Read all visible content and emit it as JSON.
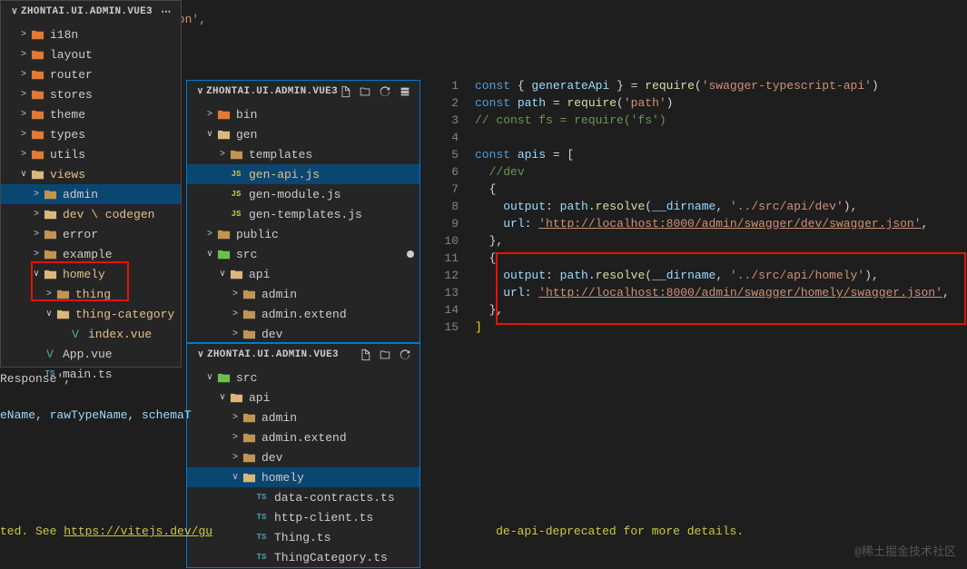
{
  "header_title": "ZHONTAI.UI.ADMIN.VUE3",
  "sidebar1": {
    "items": [
      {
        "chev": ">",
        "cls": "folder-red",
        "label": "i18n",
        "ind": 1
      },
      {
        "chev": ">",
        "cls": "folder-red",
        "label": "layout",
        "ind": 1
      },
      {
        "chev": ">",
        "cls": "folder-red",
        "label": "router",
        "ind": 1
      },
      {
        "chev": ">",
        "cls": "folder-red",
        "label": "stores",
        "ind": 1
      },
      {
        "chev": ">",
        "cls": "folder-red",
        "label": "theme",
        "ind": 1
      },
      {
        "chev": ">",
        "cls": "folder-red",
        "label": "types",
        "ind": 1
      },
      {
        "chev": ">",
        "cls": "folder-red",
        "label": "utils",
        "ind": 1
      },
      {
        "chev": "∨",
        "cls": "folder-open",
        "label": "views",
        "ind": 1,
        "orange": true
      },
      {
        "chev": ">",
        "cls": "folder",
        "label": "admin",
        "ind": 2,
        "sel": true
      },
      {
        "chev": ">",
        "cls": "folder-open",
        "label": "dev \\ codegen",
        "ind": 2,
        "orange": true
      },
      {
        "chev": ">",
        "cls": "folder",
        "label": "error",
        "ind": 2
      },
      {
        "chev": ">",
        "cls": "folder",
        "label": "example",
        "ind": 2
      },
      {
        "chev": "∨",
        "cls": "folder-open",
        "label": "homely",
        "ind": 2,
        "orange": true
      },
      {
        "chev": ">",
        "cls": "folder",
        "label": "thing",
        "ind": 3,
        "orange": true
      },
      {
        "chev": "∨",
        "cls": "folder-open",
        "label": "thing-category",
        "ind": 3,
        "orange": true
      },
      {
        "chev": "",
        "cls": "file-vue",
        "file": "V",
        "label": "index.vue",
        "ind": 4,
        "orange": true
      },
      {
        "chev": "",
        "cls": "file-vue",
        "file": "V",
        "label": "App.vue",
        "ind": 2
      },
      {
        "chev": "",
        "cls": "file-ts",
        "file": "TS",
        "label": "main.ts",
        "ind": 2
      }
    ]
  },
  "sidebar2": {
    "items": [
      {
        "chev": ">",
        "cls": "folder-red",
        "label": "bin",
        "ind": 1,
        "red": true
      },
      {
        "chev": "∨",
        "cls": "folder-open",
        "label": "gen",
        "ind": 1
      },
      {
        "chev": ">",
        "cls": "folder",
        "label": "templates",
        "ind": 2
      },
      {
        "chev": "",
        "cls": "file-js",
        "file": "JS",
        "label": "gen-api.js",
        "ind": 2,
        "sel": true,
        "orange": true
      },
      {
        "chev": "",
        "cls": "file-js",
        "file": "JS",
        "label": "gen-module.js",
        "ind": 2
      },
      {
        "chev": "",
        "cls": "file-js",
        "file": "JS",
        "label": "gen-templates.js",
        "ind": 2
      },
      {
        "chev": ">",
        "cls": "folder",
        "label": "public",
        "ind": 1
      },
      {
        "chev": "∨",
        "cls": "folder-src",
        "label": "src",
        "ind": 1,
        "dot": true
      },
      {
        "chev": "∨",
        "cls": "folder-open",
        "label": "api",
        "ind": 2
      },
      {
        "chev": ">",
        "cls": "folder",
        "label": "admin",
        "ind": 3
      },
      {
        "chev": ">",
        "cls": "folder",
        "label": "admin.extend",
        "ind": 3
      },
      {
        "chev": ">",
        "cls": "folder",
        "label": "dev",
        "ind": 3
      }
    ]
  },
  "sidebar3": {
    "items": [
      {
        "chev": "∨",
        "cls": "folder-src",
        "label": "src",
        "ind": 1
      },
      {
        "chev": "∨",
        "cls": "folder-open",
        "label": "api",
        "ind": 2
      },
      {
        "chev": ">",
        "cls": "folder",
        "label": "admin",
        "ind": 3
      },
      {
        "chev": ">",
        "cls": "folder",
        "label": "admin.extend",
        "ind": 3
      },
      {
        "chev": ">",
        "cls": "folder",
        "label": "dev",
        "ind": 3
      },
      {
        "chev": "∨",
        "cls": "folder-open",
        "label": "homely",
        "ind": 3,
        "sel": true
      },
      {
        "chev": "",
        "cls": "file-ts",
        "file": "TS",
        "label": "data-contracts.ts",
        "ind": 4
      },
      {
        "chev": "",
        "cls": "file-ts",
        "file": "TS",
        "label": "http-client.ts",
        "ind": 4
      },
      {
        "chev": "",
        "cls": "file-ts",
        "file": "TS",
        "label": "Thing.ts",
        "ind": 4
      },
      {
        "chev": "",
        "cls": "file-ts",
        "file": "TS",
        "label": "ThingCategory.ts",
        "ind": 4
      }
    ]
  },
  "code_snippet": "son',",
  "code": {
    "lines": [
      1,
      2,
      3,
      4,
      5,
      6,
      7,
      8,
      9,
      10,
      11,
      12,
      13,
      14,
      15
    ],
    "l1_kw": "const",
    "l1_br": " { ",
    "l1_var": "generateApi",
    "l1_br2": " } = ",
    "l1_fn": "require",
    "l1_p": "(",
    "l1_str": "'swagger-typescript-api'",
    "l1_p2": ")",
    "l2_kw": "const",
    "l2_var": " path",
    "l2_eq": " = ",
    "l2_fn": "require",
    "l2_p": "(",
    "l2_str": "'path'",
    "l2_p2": ")",
    "l3": "// const fs = require('fs')",
    "l5_kw": "const",
    "l5_var": " apis",
    "l5_eq": " = [",
    "l6": "//dev",
    "l7": "{",
    "l8_out": "output",
    "l8_c": ": ",
    "l8_p": "path",
    "l8_d": ".",
    "l8_r": "resolve",
    "l8_p1": "(",
    "l8_dir": "__dirname",
    "l8_cm": ", ",
    "l8_str": "'../src/api/dev'",
    "l8_p2": "),",
    "l9_url": "url",
    "l9_c": ": ",
    "l9_str": "'http://localhost:8000/admin/swagger/dev/swagger.json'",
    "l9_p": ",",
    "l10": "},",
    "l11": "{",
    "l12_out": "output",
    "l12_c": ": ",
    "l12_p": "path",
    "l12_d": ".",
    "l12_r": "resolve",
    "l12_p1": "(",
    "l12_dir": "__dirname",
    "l12_cm": ", ",
    "l12_str": "'../src/api/homely'",
    "l12_p2": "),",
    "l13_url": "url",
    "l13_c": ": ",
    "l13_str": "'http://localhost:8000/admin/swagger/homely/swagger.json'",
    "l13_p": ",",
    "l14": "},",
    "l15": "]"
  },
  "term1": "Response',",
  "term2": "eName, rawTypeName, schemaT",
  "term3_a": "ted. See ",
  "term3_b": "https://vitejs.dev/gu",
  "term3_c": "de-api-deprecated for more details.",
  "watermark": "@稀土掘金技术社区"
}
